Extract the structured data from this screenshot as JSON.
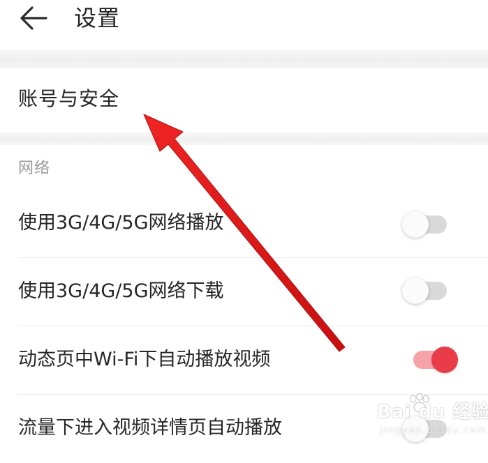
{
  "header": {
    "title": "设置",
    "back_icon": "arrow-left-icon"
  },
  "account": {
    "label": "账号与安全"
  },
  "network": {
    "section_title": "网络",
    "items": [
      {
        "label": "使用3G/4G/5G网络播放",
        "enabled": false
      },
      {
        "label": "使用3G/4G/5G网络下载",
        "enabled": false
      },
      {
        "label": "动态页中Wi-Fi下自动播放视频",
        "enabled": true
      },
      {
        "label": "流量下进入视频详情页自动播放",
        "enabled": false
      }
    ]
  },
  "colors": {
    "accent": "#ea3b48",
    "accent_track": "#f6a3a8",
    "off_track": "#d9d9d9",
    "divider": "#ececec",
    "section_title": "#9a9a9a",
    "annotation_arrow": "#e11a1a"
  },
  "annotation": {
    "type": "arrow",
    "points_to": "account-security-item"
  },
  "watermark": {
    "brand": "Bai du 经验",
    "sub": "jingyan.baidu.com"
  }
}
